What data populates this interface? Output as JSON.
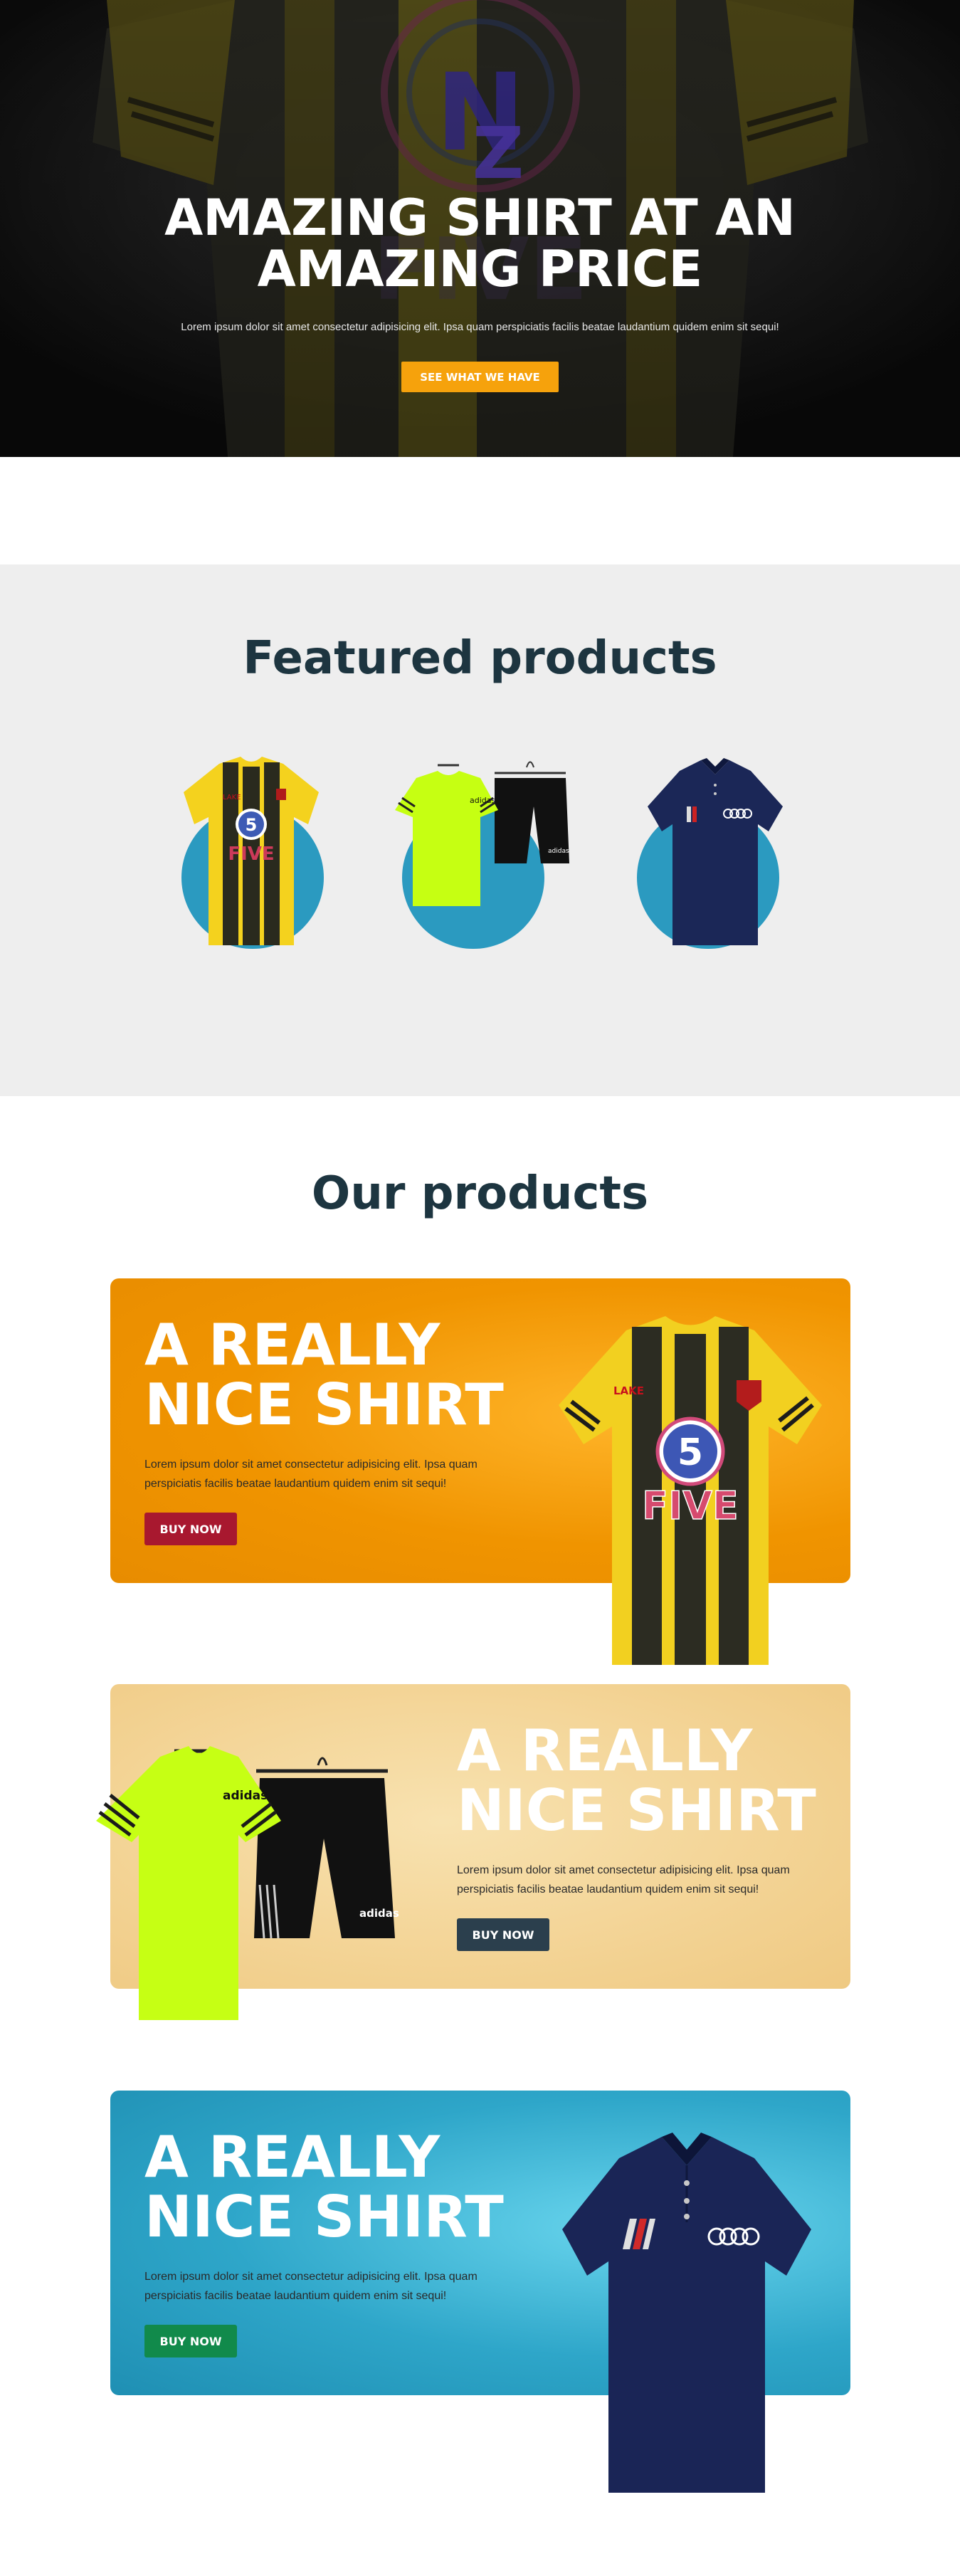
{
  "hero": {
    "title_line1": "AMAZING SHIRT AT AN",
    "title_line2": "AMAZING PRICE",
    "text": "Lorem ipsum dolor sit amet consectetur adipisicing elit. Ipsa quam perspiciatis facilis beatae laudantium quidem enim sit sequi!",
    "button": "SEE WHAT WE HAVE",
    "logo_text": "5 N Z"
  },
  "featured": {
    "title": "Featured products"
  },
  "products": {
    "title": "Our products",
    "cards": [
      {
        "title_line1": "A REALLY",
        "title_line2": "NICE SHIRT",
        "text": "Lorem ipsum dolor sit amet consectetur adipisicing elit. Ipsa quam perspiciatis facilis beatae laudantium quidem enim sit sequi!",
        "button": "BUY NOW",
        "button_color": "#a8182f",
        "bg_color": "#f29a07"
      },
      {
        "title_line1": "A REALLY",
        "title_line2": "NICE SHIRT",
        "text": "Lorem ipsum dolor sit amet consectetur adipisicing elit. Ipsa quam perspiciatis facilis beatae laudantium quidem enim sit sequi!",
        "button": "BUY NOW",
        "button_color": "#2b3f4d",
        "bg_color": "#f2d497"
      },
      {
        "title_line1": "A REALLY",
        "title_line2": "NICE SHIRT",
        "text": "Lorem ipsum dolor sit amet consectetur adipisicing elit. Ipsa quam perspiciatis facilis beatae laudantium quidem enim sit sequi!",
        "button": "BUY NOW",
        "button_color": "#118a4b",
        "bg_color": "#2ea6c9"
      }
    ]
  },
  "colors": {
    "accent": "#f6a20c",
    "heading": "#1d3540",
    "featured_bg": "#eeeeee",
    "featured_circle": "#2b9ac0"
  }
}
